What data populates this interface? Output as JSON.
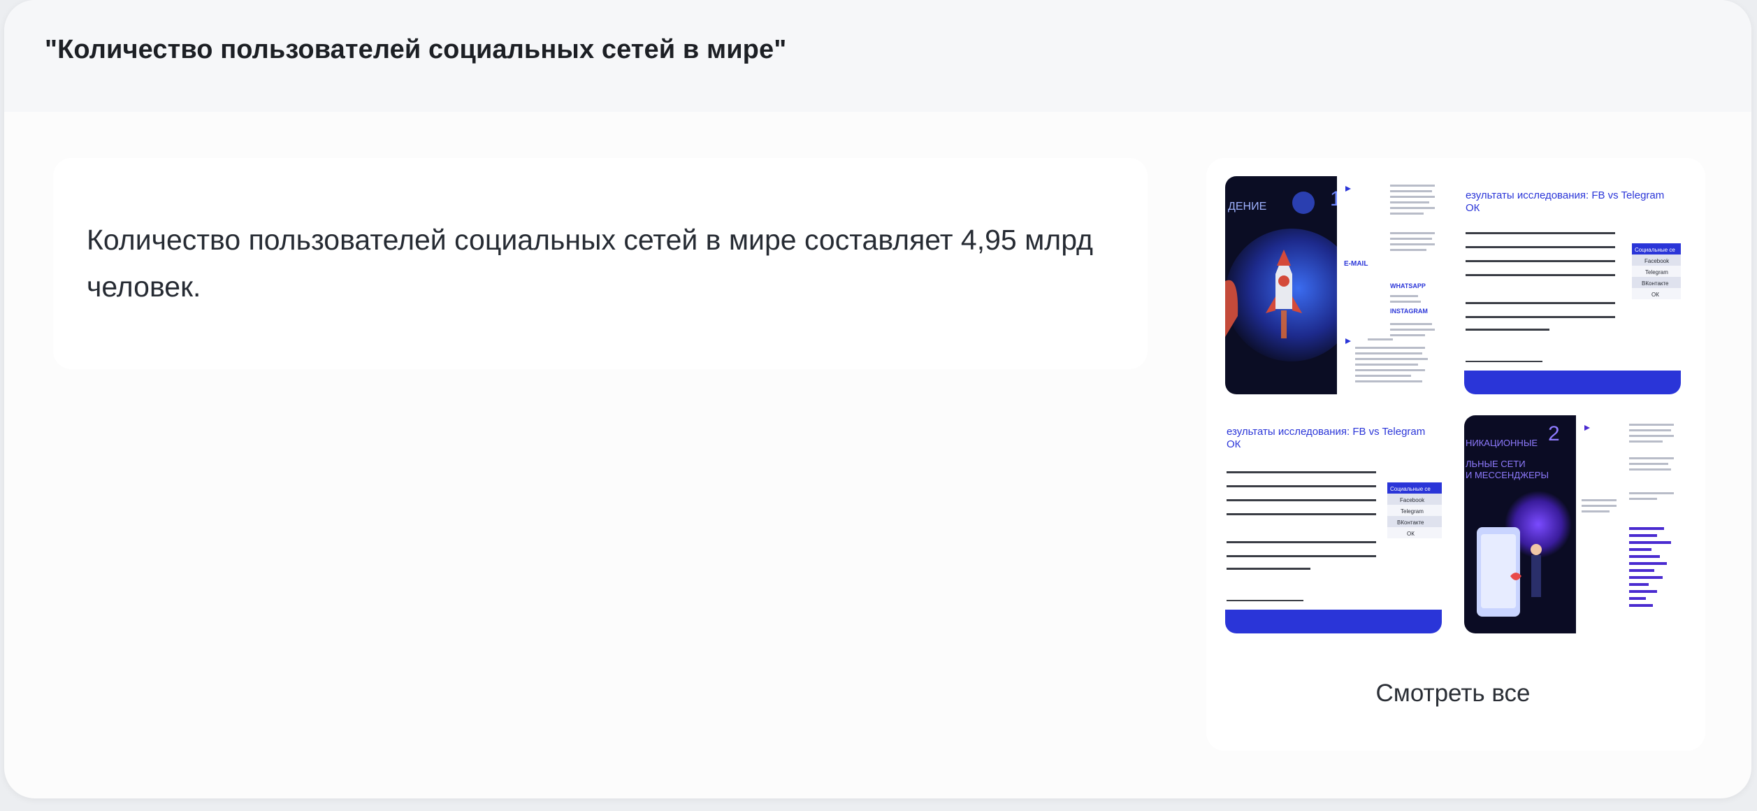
{
  "header": {
    "title": "\"Количество пользователей социальных сетей в мире\""
  },
  "answer": {
    "text": "Количество пользователей социальных сетей в мире составляет 4,95 млрд человек."
  },
  "sources": {
    "thumb1": {
      "number": "1",
      "label": "ДЕНИЕ",
      "row1": "E-MAIL",
      "row2": "WHATSAPP",
      "row3": "INSTAGRAM"
    },
    "thumb2": {
      "title": "езультаты исследования: FB vs Telegram",
      "title2": "ОК",
      "table_header": "Социальные се",
      "rows": [
        "Facebook",
        "Telegram",
        "ВКонтакте",
        "ОК"
      ]
    },
    "thumb3": {
      "title": "езультаты исследования: FB vs Telegram",
      "title2": "ОК",
      "table_header": "Социальные се",
      "rows": [
        "Facebook",
        "Telegram",
        "ВКонтакте",
        "ОК"
      ]
    },
    "thumb4": {
      "number": "2",
      "line1": "НИКАЦИОННЫЕ",
      "line2": "ЛЬНЫЕ СЕТИ",
      "line3": "И МЕССЕНДЖЕРЫ"
    },
    "see_all_label": "Смотреть все"
  },
  "colors": {
    "accent_blue": "#2a35d8",
    "dark_navy": "#0d0f2b",
    "purple": "#4a2bd0"
  }
}
